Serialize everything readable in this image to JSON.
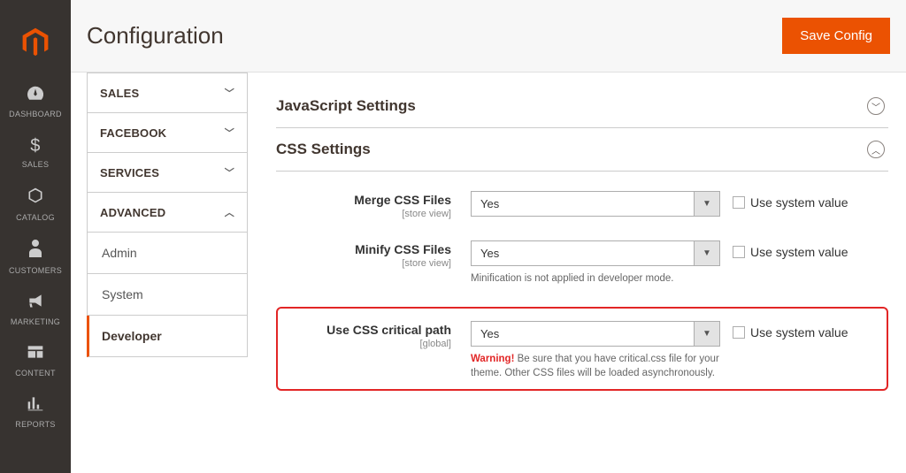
{
  "nav": {
    "items": [
      {
        "label": "DASHBOARD"
      },
      {
        "label": "SALES"
      },
      {
        "label": "CATALOG"
      },
      {
        "label": "CUSTOMERS"
      },
      {
        "label": "MARKETING"
      },
      {
        "label": "CONTENT"
      },
      {
        "label": "REPORTS"
      }
    ]
  },
  "header": {
    "title": "Configuration",
    "save_label": "Save Config"
  },
  "config_sidebar": {
    "sales": "SALES",
    "facebook": "FACEBOOK",
    "services": "SERVICES",
    "advanced": "ADVANCED",
    "admin": "Admin",
    "system": "System",
    "developer": "Developer"
  },
  "sections": {
    "js": "JavaScript Settings",
    "css": "CSS Settings"
  },
  "fields": {
    "merge": {
      "label": "Merge CSS Files",
      "scope": "[store view]",
      "value": "Yes"
    },
    "minify": {
      "label": "Minify CSS Files",
      "scope": "[store view]",
      "value": "Yes",
      "hint": "Minification is not applied in developer mode."
    },
    "critical": {
      "label": "Use CSS critical path",
      "scope": "[global]",
      "value": "Yes",
      "warn_label": "Warning!",
      "warn_text": " Be sure that you have critical.css file for your theme. Other CSS files will be loaded asynchronously."
    }
  },
  "use_system_value": "Use system value"
}
